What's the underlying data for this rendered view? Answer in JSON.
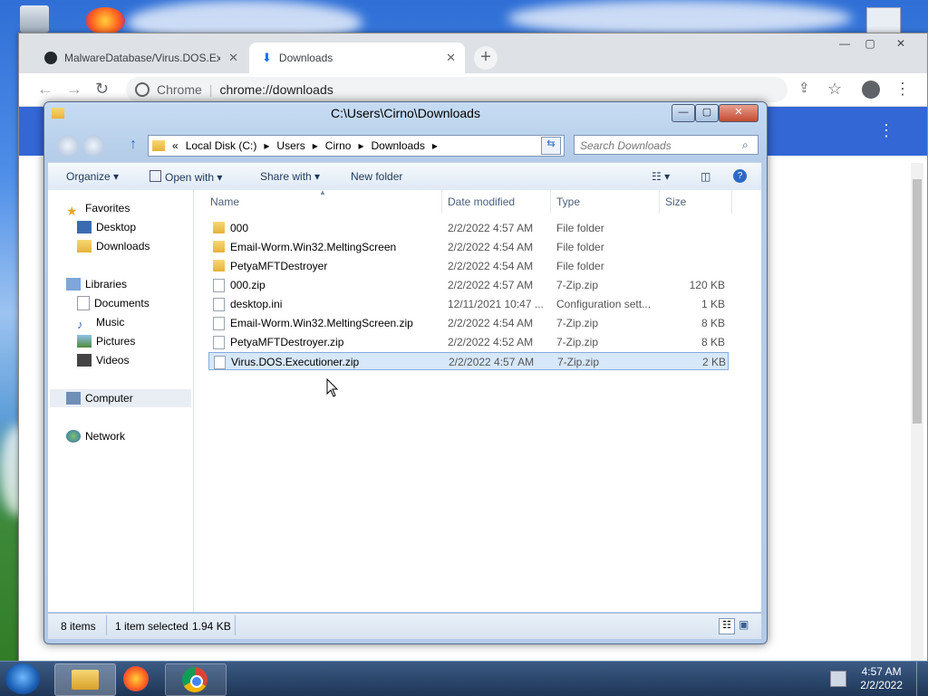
{
  "chrome": {
    "tabs": [
      {
        "title": "MalwareDatabase/Virus.DOS.Exe",
        "icon": "github-icon"
      },
      {
        "title": "Downloads",
        "icon": "download-icon"
      }
    ],
    "new_tab": "+",
    "omnibox_label": "Chrome",
    "omnibox_url": "chrome://downloads",
    "window_buttons": {
      "min": "—",
      "max": "▢",
      "close": "✕"
    }
  },
  "explorer": {
    "title": "C:\\Users\\Cirno\\Downloads",
    "address": {
      "overflow": "«",
      "crumbs": [
        "Local Disk (C:)",
        "Users",
        "Cirno",
        "Downloads"
      ]
    },
    "search_placeholder": "Search Downloads",
    "commands": {
      "organize": "Organize",
      "open_with": "Open with",
      "share_with": "Share with",
      "new_folder": "New folder"
    },
    "nav": {
      "favorites": "Favorites",
      "desktop": "Desktop",
      "downloads": "Downloads",
      "libraries": "Libraries",
      "documents": "Documents",
      "music": "Music",
      "pictures": "Pictures",
      "videos": "Videos",
      "computer": "Computer",
      "network": "Network"
    },
    "columns": {
      "name": "Name",
      "date": "Date modified",
      "type": "Type",
      "size": "Size"
    },
    "files": [
      {
        "name": "000",
        "date": "2/2/2022 4:57 AM",
        "type": "File folder",
        "size": "",
        "kind": "folder"
      },
      {
        "name": "Email-Worm.Win32.MeltingScreen",
        "date": "2/2/2022 4:54 AM",
        "type": "File folder",
        "size": "",
        "kind": "folder"
      },
      {
        "name": "PetyaMFTDestroyer",
        "date": "2/2/2022 4:54 AM",
        "type": "File folder",
        "size": "",
        "kind": "folder"
      },
      {
        "name": "000.zip",
        "date": "2/2/2022 4:57 AM",
        "type": "7-Zip.zip",
        "size": "120 KB",
        "kind": "zip"
      },
      {
        "name": "desktop.ini",
        "date": "12/11/2021 10:47 ...",
        "type": "Configuration sett...",
        "size": "1 KB",
        "kind": "ini"
      },
      {
        "name": "Email-Worm.Win32.MeltingScreen.zip",
        "date": "2/2/2022 4:54 AM",
        "type": "7-Zip.zip",
        "size": "8 KB",
        "kind": "zip"
      },
      {
        "name": "PetyaMFTDestroyer.zip",
        "date": "2/2/2022 4:52 AM",
        "type": "7-Zip.zip",
        "size": "8 KB",
        "kind": "zip"
      },
      {
        "name": "Virus.DOS.Executioner.zip",
        "date": "2/2/2022 4:57 AM",
        "type": "7-Zip.zip",
        "size": "2 KB",
        "kind": "zip",
        "selected": true
      }
    ],
    "status": {
      "count": "8 items",
      "selected": "1 item selected",
      "size": "1.94 KB"
    }
  },
  "taskbar": {
    "time": "4:57 AM",
    "date": "2/2/2022"
  },
  "colors": {
    "selection": "#d7e8fb",
    "chrome_blue": "#3367d6",
    "explorer_frame": "#b5cde9"
  }
}
